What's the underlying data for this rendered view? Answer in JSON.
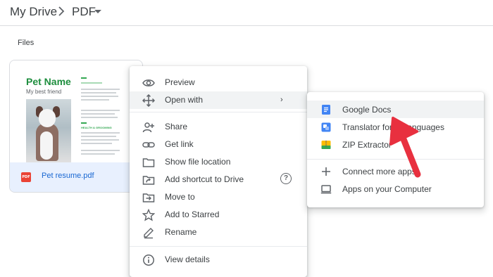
{
  "breadcrumb": {
    "root": "My Drive",
    "separator": ">",
    "current": "PDF",
    "caret_icon": "caret-down-icon"
  },
  "section": {
    "files_label": "Files"
  },
  "file_card": {
    "thumbnail": {
      "title": "Pet Name",
      "subtitle": "My best friend",
      "section_head": "HEALTH & GROOMING"
    },
    "file_type_badge": "PDF",
    "filename": "Pet resume.pdf"
  },
  "context_menu": {
    "items": [
      {
        "label": "Preview",
        "icon": "eye-icon"
      },
      {
        "label": "Open with",
        "icon": "move-arrows-icon",
        "submenu_arrow": "›"
      },
      {
        "label": "Share",
        "icon": "person-add-icon"
      },
      {
        "label": "Get link",
        "icon": "link-icon"
      },
      {
        "label": "Show file location",
        "icon": "folder-icon"
      },
      {
        "label": "Add shortcut to Drive",
        "icon": "shortcut-icon",
        "help": "?"
      },
      {
        "label": "Move to",
        "icon": "move-to-folder-icon"
      },
      {
        "label": "Add to Starred",
        "icon": "star-icon"
      },
      {
        "label": "Rename",
        "icon": "pencil-icon"
      },
      {
        "label": "View details",
        "icon": "info-icon"
      }
    ]
  },
  "open_with_menu": {
    "items": [
      {
        "label": "Google Docs",
        "icon": "google-docs-icon"
      },
      {
        "label": "Translator for all languages",
        "icon": "translator-icon"
      },
      {
        "label": "ZIP Extractor",
        "icon": "zip-extractor-icon"
      },
      {
        "label": "Connect more apps",
        "icon": "plus-icon"
      },
      {
        "label": "Apps on your Computer",
        "icon": "computer-icon"
      }
    ]
  },
  "colors": {
    "annotation_arrow": "#e8303f",
    "selected_bg": "#e8f0fe",
    "hover_bg": "#f1f3f4",
    "docs_blue": "#4285f4",
    "pdf_red": "#ea4335"
  }
}
